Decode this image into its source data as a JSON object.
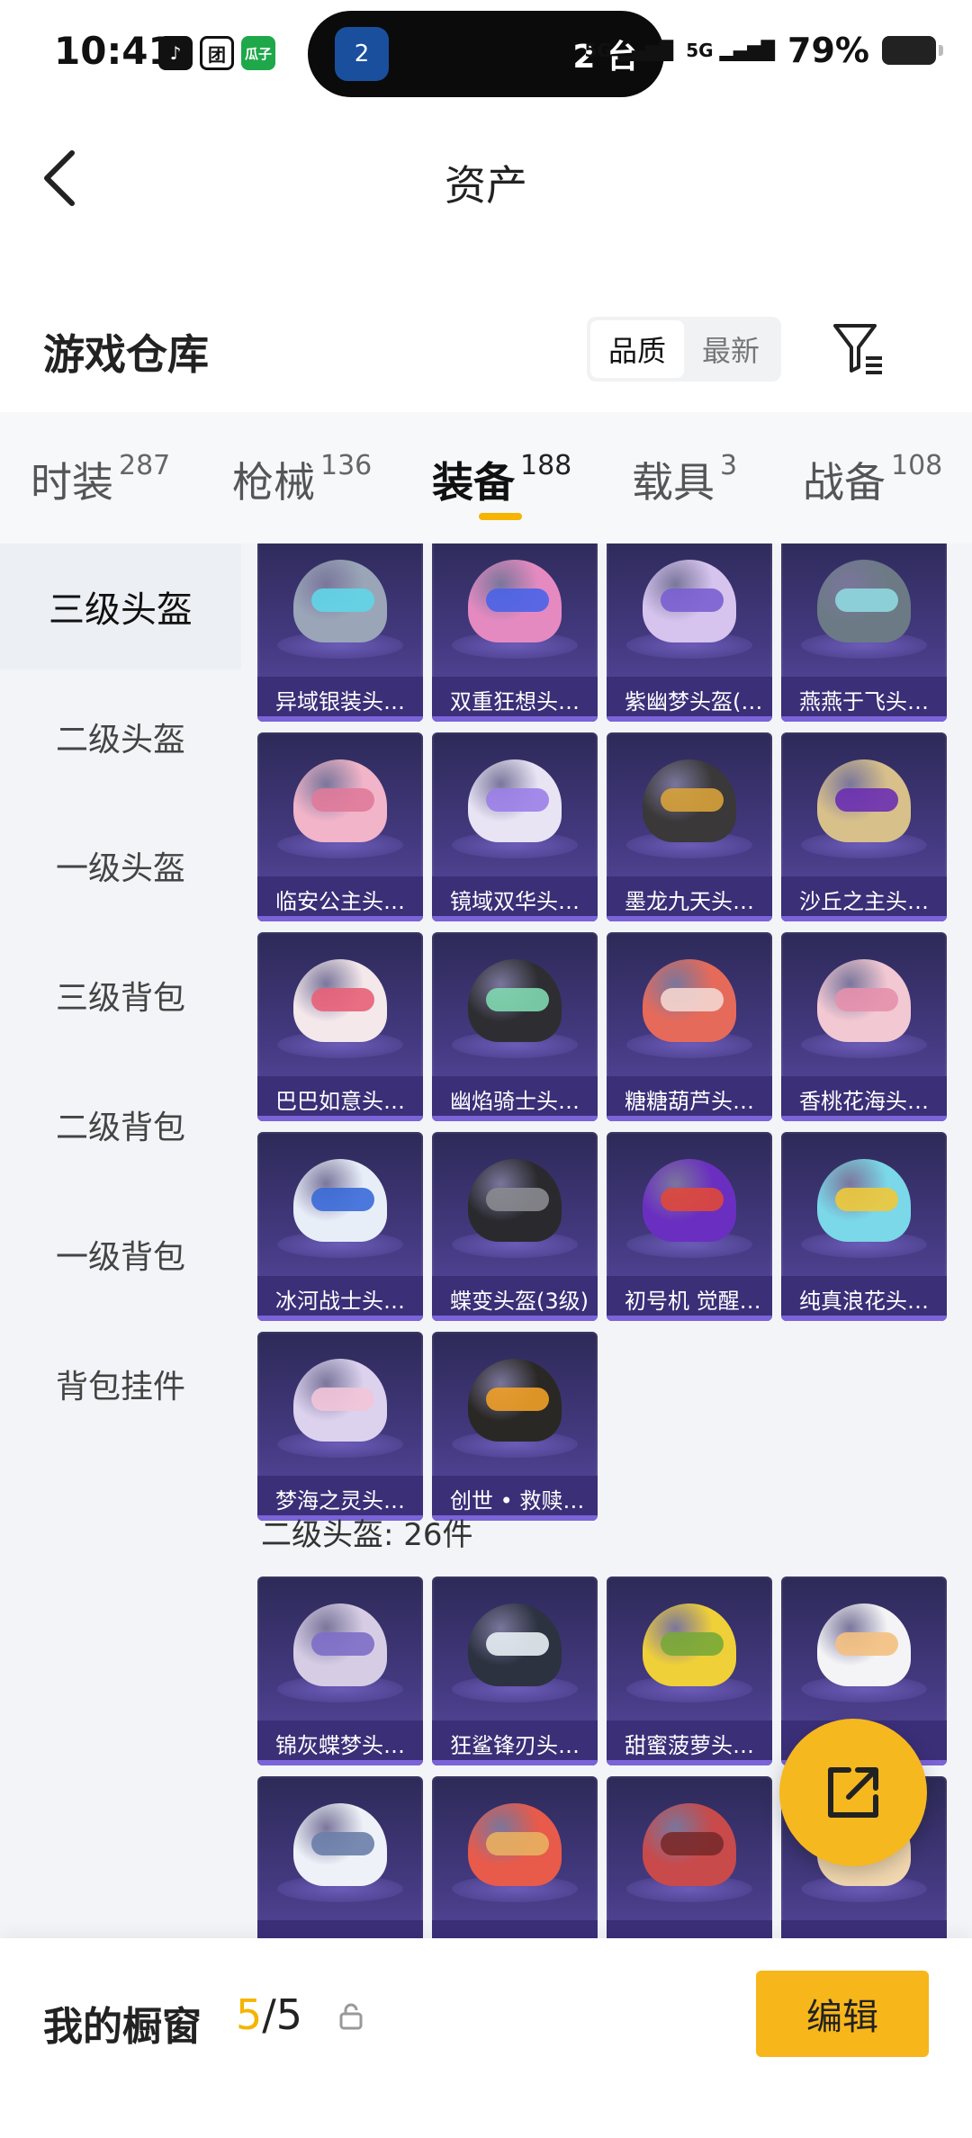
{
  "status_bar": {
    "time": "10:41",
    "apps": [
      "tiktok-icon",
      "tuan-icon",
      "guazi-icon"
    ],
    "app_labels": [
      "♪",
      "团",
      "瓜子"
    ],
    "island_badge": "2",
    "island_text": "2 台",
    "network_1": "5G",
    "network_2": "5G",
    "battery": "79%"
  },
  "header": {
    "title": "资产"
  },
  "section": {
    "title": "游戏仓库",
    "sort_options": [
      "品质",
      "最新"
    ],
    "sort_selected": "品质"
  },
  "tabs": [
    {
      "label": "时装",
      "count": "287",
      "active": false
    },
    {
      "label": "枪械",
      "count": "136",
      "active": false
    },
    {
      "label": "装备",
      "count": "188",
      "active": true
    },
    {
      "label": "载具",
      "count": "3",
      "active": false
    },
    {
      "label": "战备",
      "count": "108",
      "active": false
    }
  ],
  "sidebar": {
    "items": [
      {
        "label": "三级头盔",
        "active": true
      },
      {
        "label": "二级头盔",
        "active": false
      },
      {
        "label": "一级头盔",
        "active": false
      },
      {
        "label": "三级背包",
        "active": false
      },
      {
        "label": "二级背包",
        "active": false
      },
      {
        "label": "一级背包",
        "active": false
      },
      {
        "label": "背包挂件",
        "active": false
      }
    ]
  },
  "groups": [
    {
      "items": [
        {
          "name": "异域银装头…",
          "color": "#9aa6b8",
          "visor": "#5fd6e8"
        },
        {
          "name": "双重狂想头…",
          "color": "#e58ac0",
          "visor": "#4a63e8"
        },
        {
          "name": "紫幽梦头盔(…",
          "color": "#d6c4ee",
          "visor": "#7a5fd0"
        },
        {
          "name": "燕燕于飞头…",
          "color": "#6c7a86",
          "visor": "#8fd8e0"
        },
        {
          "name": "临安公主头…",
          "color": "#f2b4c8",
          "visor": "#e07a9a"
        },
        {
          "name": "镜域双华头…",
          "color": "#e8e4f4",
          "visor": "#9b7fe8"
        },
        {
          "name": "墨龙九天头…",
          "color": "#3a3838",
          "visor": "#d8a23a"
        },
        {
          "name": "沙丘之主头…",
          "color": "#d8c08a",
          "visor": "#6a2fb0"
        },
        {
          "name": "巴巴如意头…",
          "color": "#f4e8ea",
          "visor": "#e86078"
        },
        {
          "name": "幽焰骑士头…",
          "color": "#2e2e32",
          "visor": "#7fd8b0"
        },
        {
          "name": "糖糖葫芦头…",
          "color": "#e66a5a",
          "visor": "#f3d6d0"
        },
        {
          "name": "香桃花海头…",
          "color": "#f2c8d2",
          "visor": "#e690ac"
        },
        {
          "name": "冰河战士头…",
          "color": "#e8eef8",
          "visor": "#3a6ad8"
        },
        {
          "name": "蝶变头盔(3级)",
          "color": "#2a2a2e",
          "visor": "#8a8a90"
        },
        {
          "name": "初号机 觉醒…",
          "color": "#6a2fc0",
          "visor": "#e0483a"
        },
        {
          "name": "纯真浪花头…",
          "color": "#7ad8e8",
          "visor": "#f0c83a"
        },
        {
          "name": "梦海之灵头…",
          "color": "#dcd2ee",
          "visor": "#f2c4d8"
        },
        {
          "name": "创世 • 救赎…",
          "color": "#2a2824",
          "visor": "#f0a028"
        }
      ]
    },
    {
      "header": "二级头盔: 26件",
      "items": [
        {
          "name": "锦灰蝶梦头…",
          "color": "#d6cde4",
          "visor": "#7d6ec8"
        },
        {
          "name": "狂鲨锋刃头…",
          "color": "#2c3240",
          "visor": "#e8eef4"
        },
        {
          "name": "甜蜜菠萝头…",
          "color": "#f0d038",
          "visor": "#78a838"
        },
        {
          "name": "",
          "color": "#f4f4f6",
          "visor": "#f4c080"
        },
        {
          "name": "",
          "color": "#eef2f8",
          "visor": "#6a7ea8"
        },
        {
          "name": "",
          "color": "#e85a4a",
          "visor": "#e8b060"
        },
        {
          "name": "",
          "color": "#c84a4a",
          "visor": "#7a2a2a"
        },
        {
          "name": "",
          "color": "#f2d8b0",
          "visor": "#7ac8c0"
        }
      ]
    }
  ],
  "bottom_bar": {
    "label": "我的橱窗",
    "current": "5",
    "separator": "/",
    "total": "5",
    "edit_label": "编辑"
  }
}
